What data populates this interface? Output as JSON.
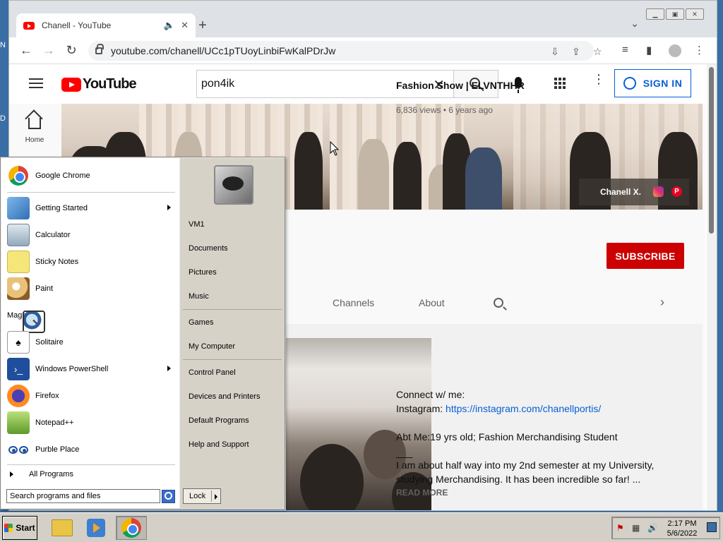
{
  "browser": {
    "tab_title": "Chanell - YouTube",
    "url": "youtube.com/chanell/UCc1pTUoyLinbiFwKalPDrJw"
  },
  "youtube": {
    "search_value": "pon4ik",
    "sign_in_label": "SIGN IN",
    "home_label": "Home",
    "banner_name": "Chanell X.",
    "subscribe_label": "SUBSCRIBE",
    "channel_tabs": [
      "Channels",
      "About"
    ],
    "video": {
      "title": "Fashion Show | ELVNTHHR",
      "meta": "6,836 views • 6 years ago",
      "desc_line1": "Connect w/ me:",
      "desc_ig_label": "Instagram: ",
      "desc_ig_link": "https://instagram.com/chanellportis/",
      "desc_about": "Abt Me:19 yrs old; Fashion Merchandising Student",
      "desc_rule": "___",
      "desc_body": "I am about half way into my 2nd semester at my University, studying Merchandising. It has been incredible so far! ...",
      "read_more": "READ MORE"
    }
  },
  "start_menu": {
    "left_items": [
      "Google Chrome",
      "Getting Started",
      "Calculator",
      "Sticky Notes",
      "Paint",
      "Magnifier",
      "Solitaire",
      "Windows PowerShell",
      "Firefox",
      "Notepad++",
      "Purble Place"
    ],
    "all_programs": "All Programs",
    "search_placeholder": "Search programs and files",
    "right_items": [
      "VM1",
      "Documents",
      "Pictures",
      "Music",
      "Games",
      "My Computer",
      "Control Panel",
      "Devices and Printers",
      "Default Programs",
      "Help and Support"
    ],
    "lock_label": "Lock"
  },
  "taskbar": {
    "start_label": "Start",
    "time": "2:17 PM",
    "date": "5/6/2022"
  },
  "desktop": {
    "frag1": "N",
    "frag2": "D"
  }
}
